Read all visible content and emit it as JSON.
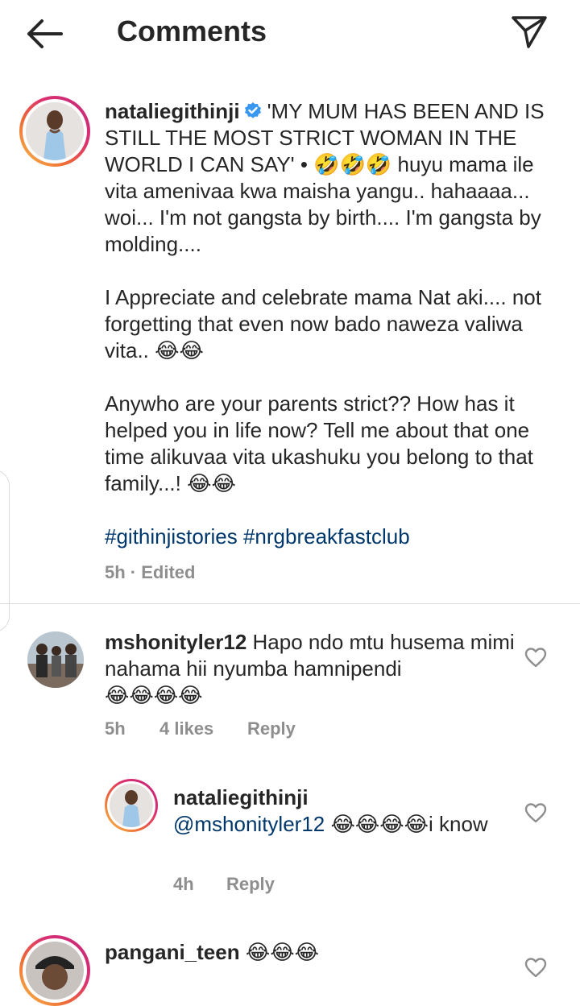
{
  "header": {
    "title": "Comments",
    "back_icon": "back-arrow-icon",
    "send_icon": "paper-plane-icon"
  },
  "caption": {
    "username": "nataliegithinji",
    "verified_icon": "verified-badge-icon",
    "line1": "'MY MUM HAS BEEN AND IS STILL THE MOST STRICT WOMAN IN THE WORLD I CAN SAY' •",
    "line1_emojis": "🤣🤣🤣",
    "line2": "huyu mama ile vita amenivaa kwa maisha yangu.. hahaaaa... woi... I'm not gangsta by birth.... I'm gangsta by molding....",
    "para2": "I Appreciate and celebrate mama Nat aki.... not forgetting that even now bado naweza valiwa vita..",
    "para2_emojis": "😂😂",
    "para3": "Anywho are your parents strict?? How has it helped you in life now? Tell me about that one time alikuvaa vita ukashuku you belong to that family...!",
    "para3_emojis": "😂😂",
    "hashtags": "#githinjistories #nrgbreakfastclub",
    "meta": "5h · Edited"
  },
  "comments": [
    {
      "username": "mshonityler12",
      "text": "Hapo ndo mtu husema mimi nahama hii nyumba hamnipendi",
      "emojis": "😂😂😂😂",
      "time": "5h",
      "likes": "4 likes",
      "reply": "Reply"
    },
    {
      "username": "nataliegithinji",
      "mention": "@mshonityler12",
      "emojis": "😂😂😂😂",
      "text": "i know",
      "time": "4h",
      "reply": "Reply"
    },
    {
      "username": "pangani_teen",
      "emojis": "😂😂😂"
    }
  ],
  "colors": {
    "text": "#262626",
    "meta": "#8e8e8e",
    "link": "#00376b",
    "verified": "#3897f0",
    "divider": "#dbdbdb"
  }
}
